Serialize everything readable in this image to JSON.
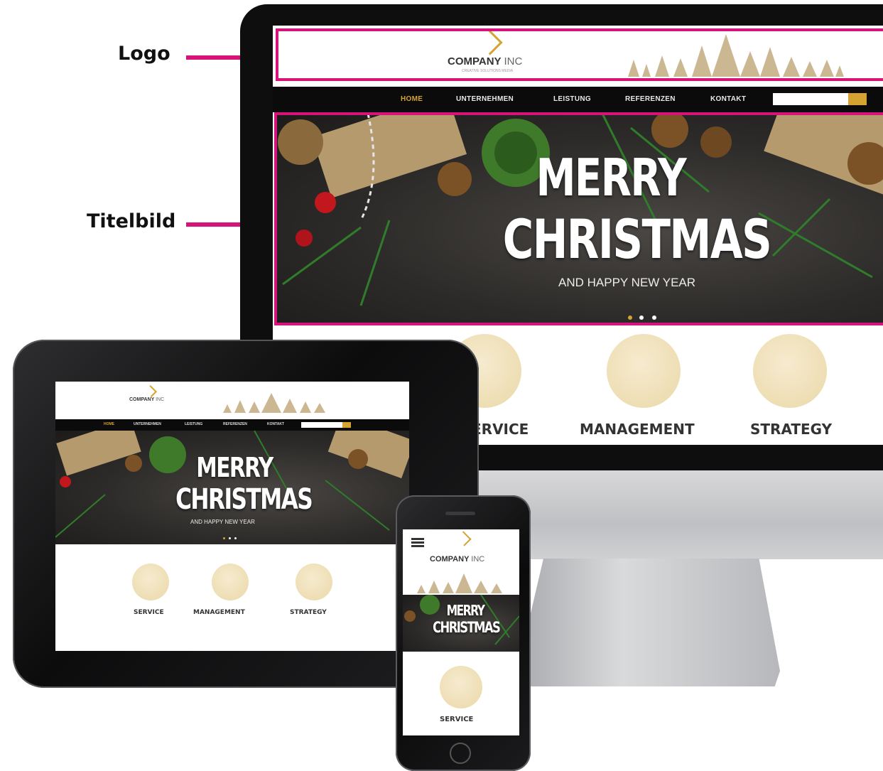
{
  "annotations": {
    "logo_label": "Logo",
    "hero_label": "Titelbild"
  },
  "brand": {
    "name": "COMPANY",
    "suffix": "INC",
    "tagline": "CREATIVE SOLUTIONS MEDIA"
  },
  "nav": {
    "items": [
      "HOME",
      "UNTERNEHMEN",
      "LEISTUNG",
      "REFERENZEN",
      "KONTAKT"
    ],
    "active": "HOME",
    "search_placeholder": ""
  },
  "hero": {
    "line1": "MERRY",
    "line2": "CHRISTMAS",
    "subtitle": "AND HAPPY NEW YEAR",
    "slides": 3,
    "active_slide": 1
  },
  "features": [
    "SERVICE",
    "MANAGEMENT",
    "STRATEGY"
  ],
  "desktop_visible_features": {
    "service": "ERVICE",
    "management": "MANAGEMENT",
    "strategy": "STRATEGY"
  },
  "colors": {
    "accent": "#d4a331",
    "highlight": "#d6137a",
    "nav_bg": "#0b0b0b"
  },
  "icons": [
    "logo-chevron-icon",
    "search-icon",
    "tablet-touch-icon",
    "handshake-bulb-icon",
    "gears-icon",
    "hamburger-menu-icon"
  ]
}
